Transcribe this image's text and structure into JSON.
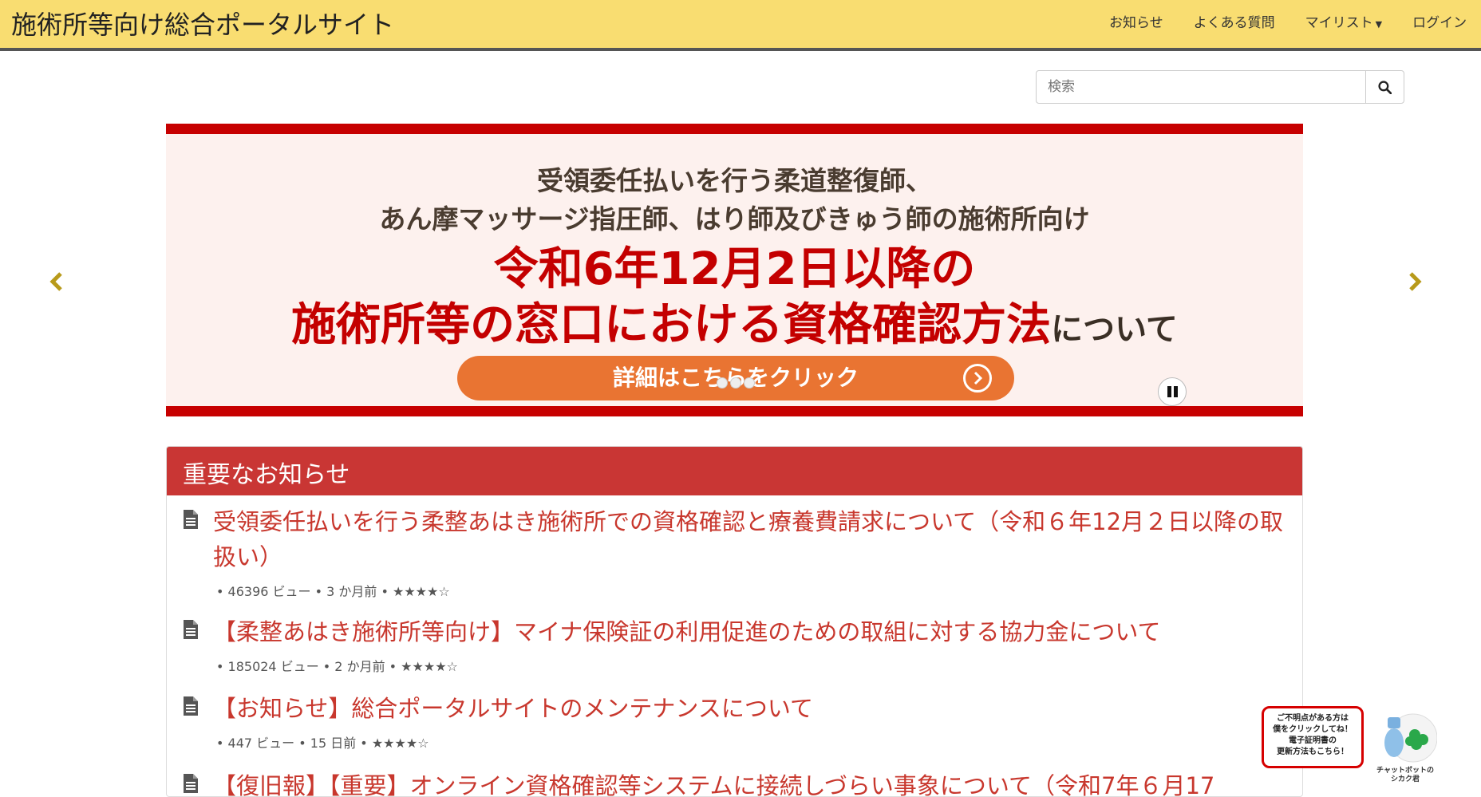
{
  "header": {
    "site_title": "施術所等向け総合ポータルサイト",
    "nav": [
      {
        "label": "お知らせ"
      },
      {
        "label": "よくある質問"
      },
      {
        "label": "マイリスト",
        "has_dropdown": true
      },
      {
        "label": "ログイン"
      }
    ]
  },
  "search": {
    "placeholder": "検索",
    "button_icon": "search-icon"
  },
  "carousel": {
    "line1": "受領委任払いを行う柔道整復師、",
    "line2": "あん摩マッサージ指圧師、はり師及びきゅう師の施術所向け",
    "line3": "令和6年12月2日以降の",
    "line4_main": "施術所等の窓口における資格確認方法",
    "line4_suffix": "について",
    "cta_label": "詳細はこちらをクリック",
    "prev_icon": "chevron-left-icon",
    "next_icon": "chevron-right-icon",
    "pause_icon": "pause-icon",
    "slide_count": 3
  },
  "important_notices": {
    "heading": "重要なお知らせ",
    "items": [
      {
        "title": "受領委任払いを行う柔整あはき施術所での資格確認と療養費請求について（令和６年12月２日以降の取扱い）",
        "meta": "•  46396 ビュー  •  3 か月前  •  ★★★★☆",
        "rating": 4
      },
      {
        "title": "【柔整あはき施術所等向け】マイナ保険証の利用促進のための取組に対する協力金について",
        "meta": "•  185024 ビュー  •  2 か月前  •  ★★★★☆",
        "rating": 4
      },
      {
        "title": "【お知らせ】総合ポータルサイトのメンテナンスについて",
        "meta": "•  447 ビュー  •  15 日前  •  ★★★★☆",
        "rating": 4
      },
      {
        "title": "【復旧報】【重要】オンライン資格確認等システムに接続しづらい事象について（令和7年６月17",
        "meta": "",
        "rating": null
      }
    ]
  },
  "chatbot": {
    "bubble_lines": [
      "ご不明点がある方は",
      "僕をクリックしてね！",
      "電子証明書の",
      "更新方法もこちら！"
    ],
    "name_lines": [
      "チャットボットの",
      "シカク君"
    ]
  },
  "colors": {
    "header_bg": "#f9dd71",
    "banner_red": "#c70000",
    "cta_orange": "#e97432",
    "panel_header": "#c93634",
    "link_red": "#c8372d",
    "arrow_gold": "#b89a1a"
  }
}
